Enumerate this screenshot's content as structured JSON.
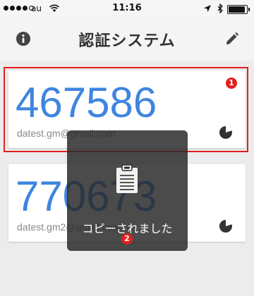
{
  "status_bar": {
    "carrier": "au",
    "time": "11:16",
    "signal_bars_filled": 4,
    "signal_bars_total": 5,
    "battery_level": 0.92
  },
  "header": {
    "title": "認証システム",
    "info_icon": "info-icon",
    "edit_icon": "pencil-icon"
  },
  "accounts": [
    {
      "code": "467586",
      "account": "datest.gm@gmail.com",
      "timer_icon": "countdown-timer-icon"
    },
    {
      "code": "770673",
      "account": "datest.gm2@gmail.com",
      "timer_icon": "countdown-timer-icon"
    }
  ],
  "toast": {
    "message": "コピーされました",
    "icon": "clipboard-icon"
  },
  "annotations": {
    "badge_1": "1",
    "badge_2": "2",
    "highlight_color": "#e1201d"
  },
  "colors": {
    "code_color": "#3f85e0",
    "background": "#ececec"
  }
}
